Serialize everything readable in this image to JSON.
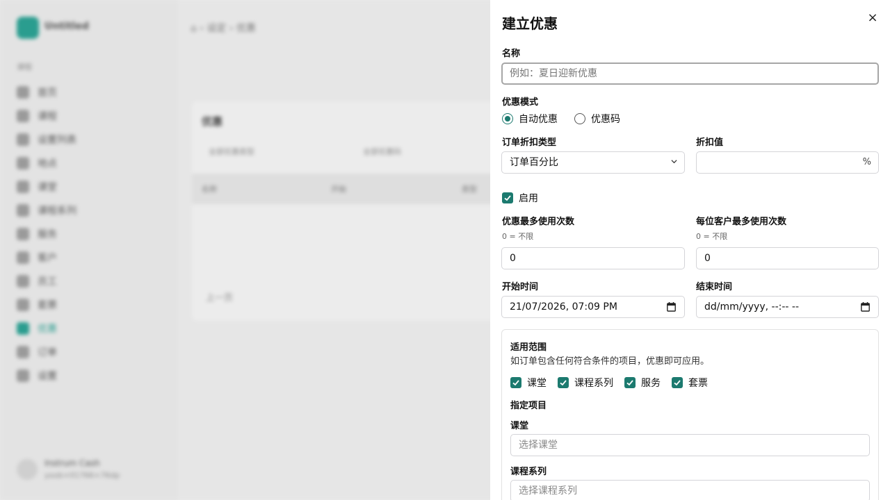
{
  "background": {
    "app_name": "Untitled",
    "section_label": "课程",
    "nav_items": [
      "首页",
      "课程",
      "设置列表",
      "地点",
      "课堂",
      "课程系列",
      "服务",
      "客户",
      "员工",
      "套票",
      "优惠",
      "订单",
      "设置"
    ],
    "active_nav": "优惠",
    "breadcrumb": "⌂  ›  设定  ›  优惠",
    "card_title": "优惠",
    "filter_1": "全部优惠类型",
    "filter_2": "全部优惠码",
    "table_headers": [
      "名称",
      "开始",
      "类型"
    ],
    "prev_label": "上一页",
    "user_name": "Instrum Cash",
    "user_email": "yoob+01766+76dp"
  },
  "drawer": {
    "title": "建立优惠",
    "close_label": "×",
    "name": {
      "label": "名称",
      "placeholder": "例如：夏日迎新优惠",
      "value": ""
    },
    "mode": {
      "label": "优惠模式",
      "options": [
        "自动优惠",
        "优惠码"
      ],
      "selected": "自动优惠"
    },
    "discount_type": {
      "label": "订单折扣类型",
      "value": "订单百分比"
    },
    "discount_value": {
      "label": "折扣值",
      "value": "",
      "suffix": "%"
    },
    "enabled": {
      "label": "启用",
      "checked": true
    },
    "max_uses": {
      "label": "优惠最多使用次数",
      "hint": "0 = 不限",
      "value": "0"
    },
    "max_uses_per_customer": {
      "label": "每位客户最多使用次数",
      "hint": "0 = 不限",
      "value": "0"
    },
    "start_time": {
      "label": "开始时间",
      "value": "21/07/2026, 07:09 PM"
    },
    "end_time": {
      "label": "结束时间",
      "value": "dd/mm/yyyy, --:-- --"
    },
    "scope": {
      "title": "适用范围",
      "description": "如订单包含任何符合条件的项目，优惠即可应用。",
      "types": [
        "课堂",
        "课程系列",
        "服务",
        "套票"
      ],
      "specific_label": "指定项目",
      "class_label": "课堂",
      "class_placeholder": "选择课堂",
      "series_label": "课程系列",
      "series_placeholder": "选择课程系列"
    }
  },
  "colors": {
    "accent": "#1c7a6f",
    "overlay": "#e9e9e9"
  }
}
